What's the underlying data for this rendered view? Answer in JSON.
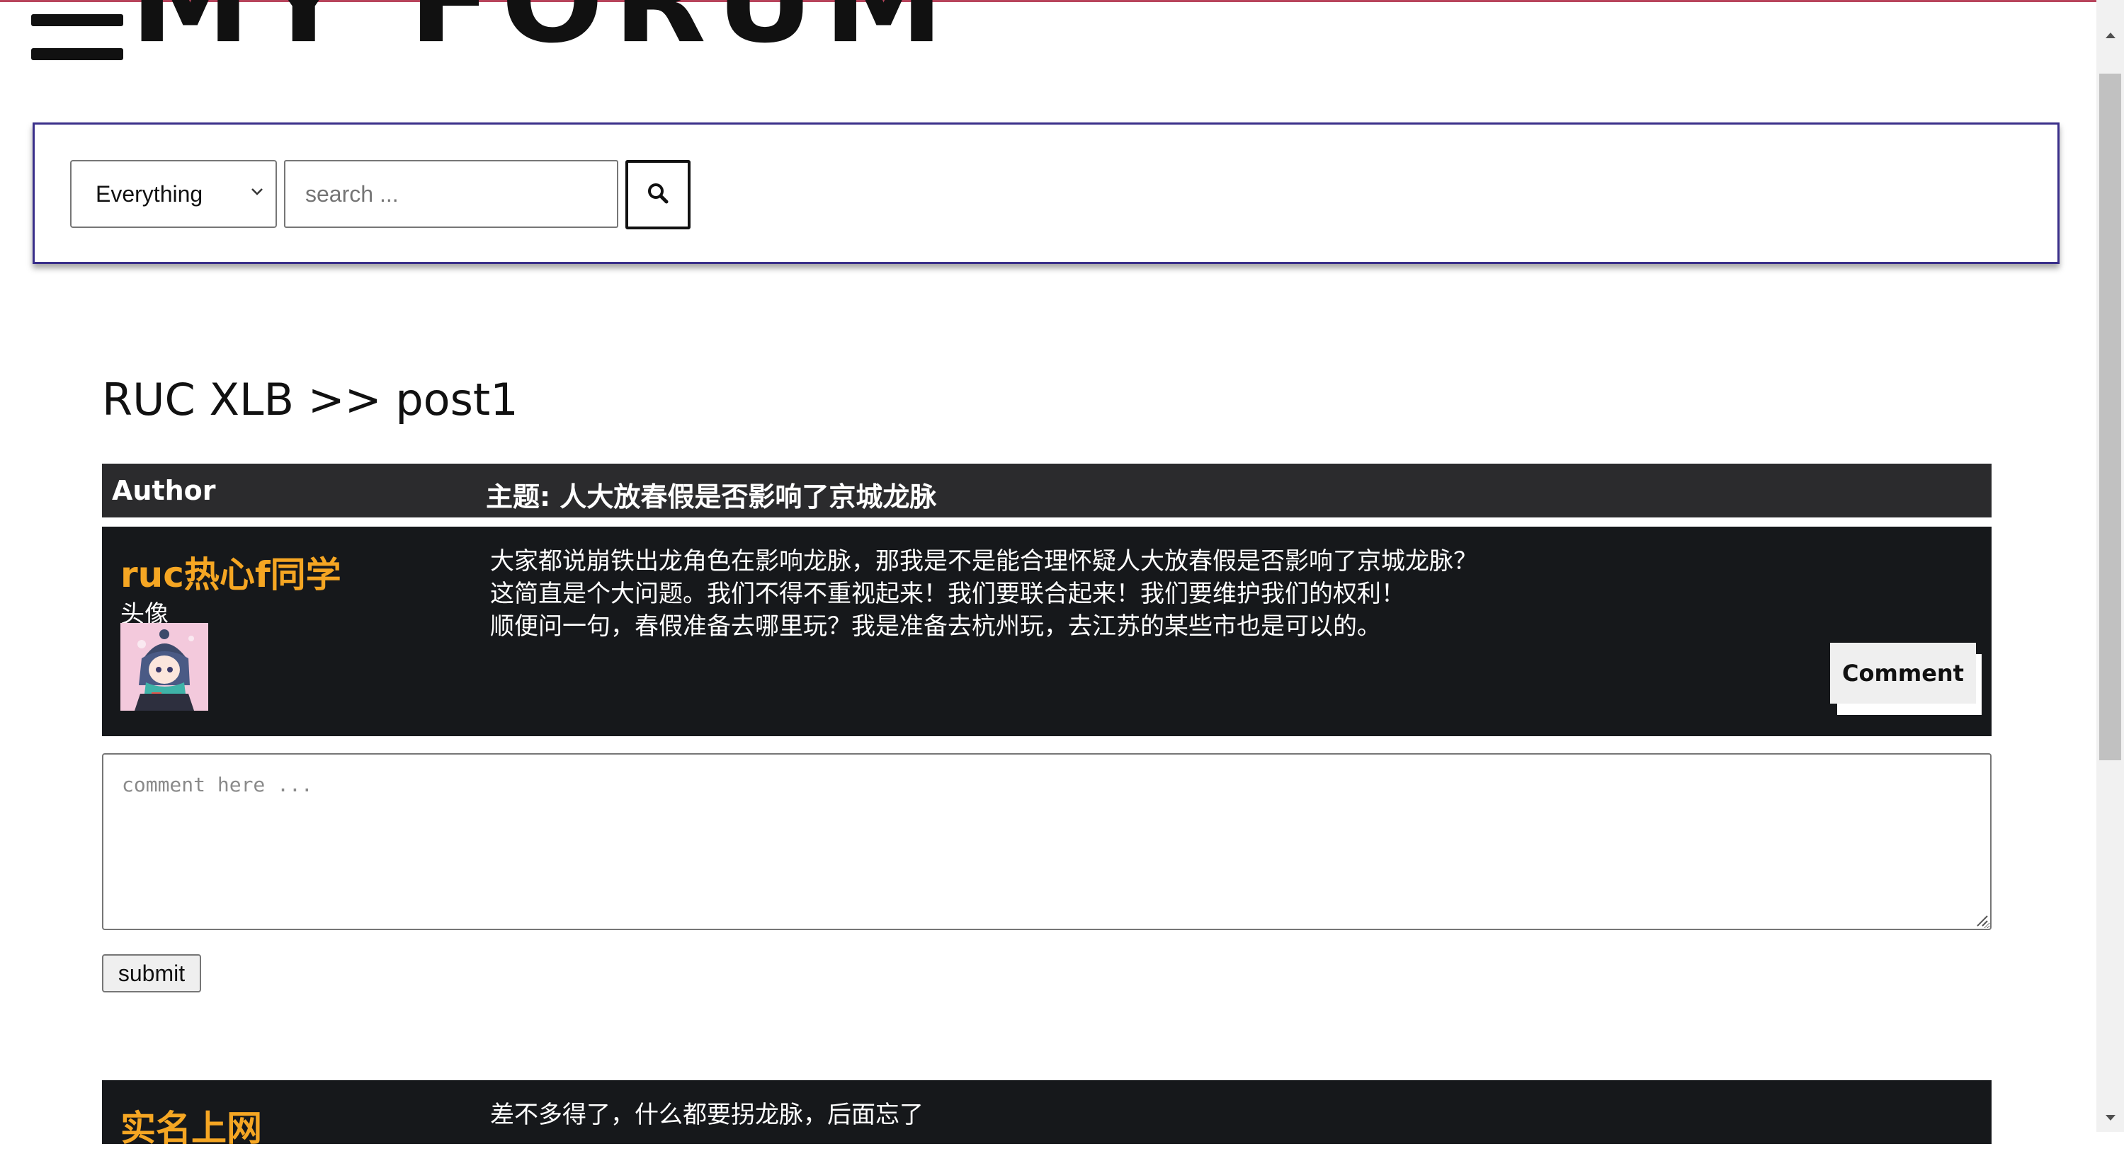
{
  "header": {
    "logo_text": "MY FORUM"
  },
  "search": {
    "scope_selected": "Everything",
    "placeholder": "search ..."
  },
  "breadcrumb": "RUC XLB >> post1",
  "table": {
    "author_header": "Author",
    "subject_header": "主题: 人大放春假是否影响了京城龙脉"
  },
  "posts": [
    {
      "author": "ruc热心f同学",
      "avatar_label": "头像",
      "lines": [
        "大家都说崩铁出龙角色在影响龙脉，那我是不是能合理怀疑人大放春假是否影响了京城龙脉？",
        "这简直是个大问题。我们不得不重视起来！我们要联合起来！我们要维护我们的权利！",
        "顺便问一句，春假准备去哪里玩？我是准备去杭州玩，去江苏的某些市也是可以的。"
      ],
      "comment_label": "Comment"
    },
    {
      "author": "实名上网",
      "lines": [
        "差不多得了，什么都要拐龙脉，后面忘了"
      ]
    }
  ],
  "comment_form": {
    "placeholder": "comment here ...",
    "submit_label": "submit"
  },
  "colors": {
    "accent_author": "#f5a623",
    "post_background": "#16181b",
    "header_background": "#2b2b2d",
    "search_border": "#3a2f8a"
  }
}
